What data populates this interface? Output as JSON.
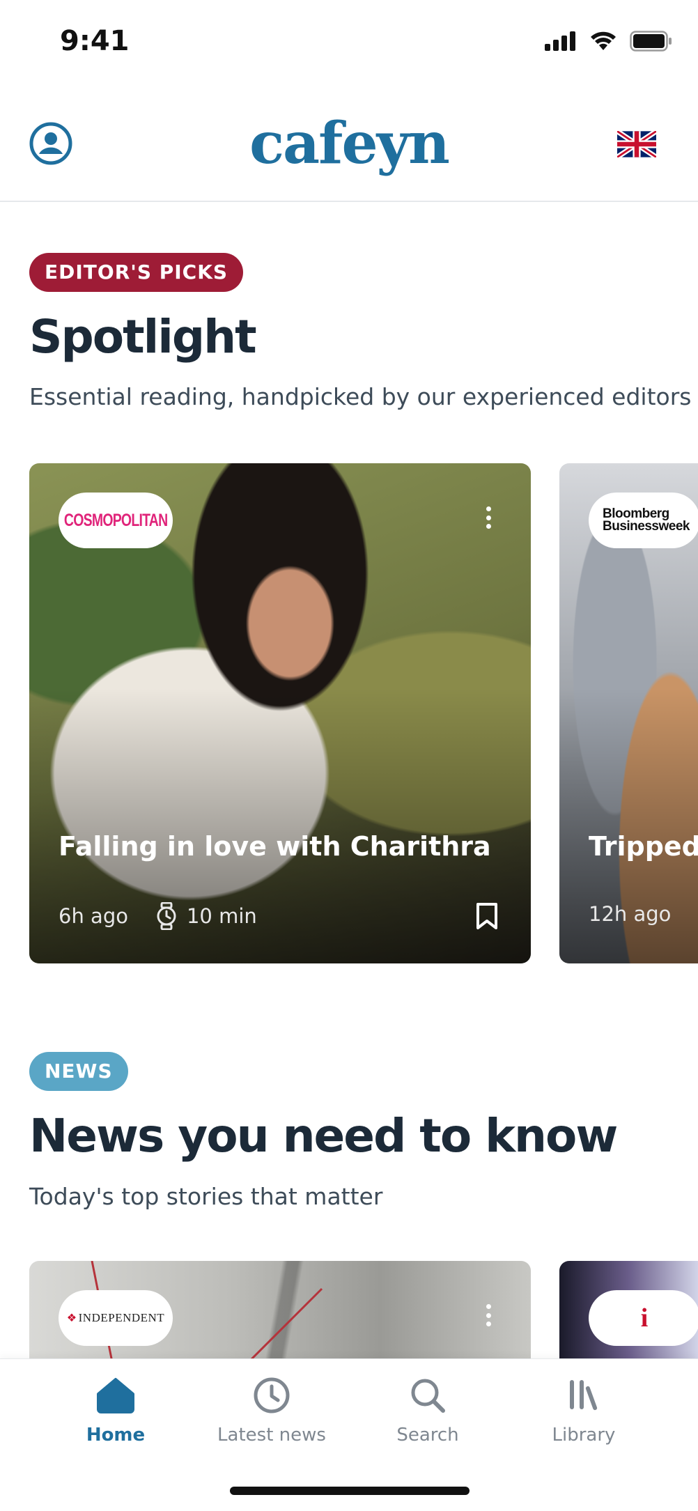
{
  "status_bar": {
    "time": "9:41"
  },
  "header": {
    "logo": "cafeyn"
  },
  "spotlight": {
    "badge": "EDITOR'S PICKS",
    "title": "Spotlight",
    "subtitle": "Essential reading, handpicked by our experienced editors",
    "cards": [
      {
        "brand": "COSMOPOLITAN",
        "title": "Falling in love with Charithra",
        "time_ago": "6h ago",
        "read_time": "10 min"
      },
      {
        "brand_line1": "Bloomberg",
        "brand_line2": "Businessweek",
        "title": "Tripped",
        "time_ago": "12h ago"
      }
    ]
  },
  "news": {
    "badge": "NEWS",
    "title": "News you need to know",
    "subtitle": "Today's top stories that matter",
    "cards": [
      {
        "brand": "INDEPENDENT"
      },
      {
        "brand": "i"
      }
    ]
  },
  "tabbar": {
    "home": "Home",
    "latest": "Latest news",
    "search": "Search",
    "library": "Library"
  },
  "colors": {
    "brand_blue": "#1f6f9e",
    "editor_badge": "#9e1c36",
    "news_badge": "#5aa6c6"
  }
}
